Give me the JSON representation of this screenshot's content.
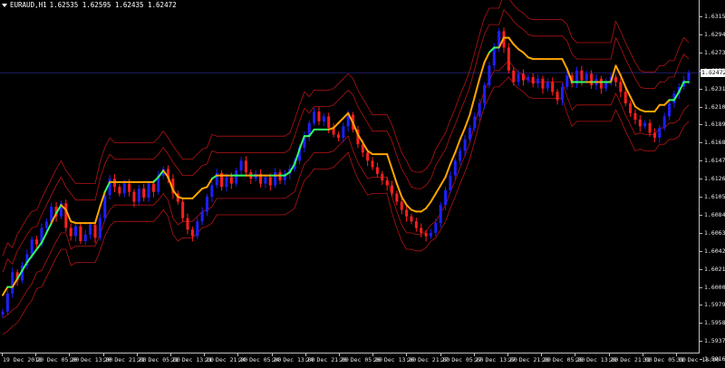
{
  "header": {
    "symbol": "EURAUD,H1",
    "ohlc": "1.62535 1.62595 1.62435 1.62472"
  },
  "price_axis": {
    "labels": [
      "1.63155",
      "1.62945",
      "1.62735",
      "1.62525",
      "1.62315",
      "1.62105",
      "1.61895",
      "1.61685",
      "1.61475",
      "1.61265",
      "1.61055",
      "1.60845",
      "1.60635",
      "1.60425",
      "1.60215",
      "1.60000",
      "1.59790",
      "1.59580",
      "1.59370",
      "1.59165"
    ],
    "current_price": "1.62472"
  },
  "time_axis": {
    "labels": [
      "19 Dec 2018",
      "20 Dec 05:00",
      "20 Dec 13:00",
      "20 Dec 21:00",
      "21 Dec 05:00",
      "21 Dec 13:00",
      "21 Dec 21:00",
      "24 Dec 05:00",
      "24 Dec 13:00",
      "24 Dec 21:00",
      "26 Dec 05:00",
      "26 Dec 13:00",
      "26 Dec 21:00",
      "27 Dec 05:00",
      "27 Dec 13:00",
      "27 Dec 21:00",
      "28 Dec 05:00",
      "28 Dec 13:00",
      "28 Dec 21:00",
      "31 Dec 05:00",
      "31 Dec 13:00"
    ]
  },
  "colors": {
    "background": "#000000",
    "bull_candle": "#1f1fff",
    "bear_candle": "#ff1f1f",
    "trend_up_line": "#33ff66",
    "trend_down_line": "#ffa500",
    "envelope_lines": "#b31414",
    "grid_line": "#1c1c60",
    "axis_text": "#e8e8e8"
  },
  "chart_data": {
    "type": "candlestick",
    "ylim": [
      1.5906,
      1.6336
    ],
    "close_series": [
      1.5956,
      1.5978,
      1.6004,
      1.5994,
      1.6012,
      1.6026,
      1.6044,
      1.6038,
      1.6058,
      1.6066,
      1.6084,
      1.6072,
      1.6088,
      1.6058,
      1.6048,
      1.606,
      1.6042,
      1.605,
      1.6062,
      1.6046,
      1.607,
      1.6098,
      1.6118,
      1.6108,
      1.61,
      1.6112,
      1.6102,
      1.609,
      1.6106,
      1.6095,
      1.6112,
      1.6102,
      1.6122,
      1.613,
      1.6118,
      1.61,
      1.609,
      1.607,
      1.6056,
      1.6048,
      1.6066,
      1.6078,
      1.6096,
      1.611,
      1.6125,
      1.6108,
      1.612,
      1.6112,
      1.6128,
      1.614,
      1.6126,
      1.6118,
      1.6124,
      1.6112,
      1.612,
      1.611,
      1.6126,
      1.6116,
      1.6124,
      1.613,
      1.614,
      1.6156,
      1.617,
      1.6186,
      1.62,
      1.6188,
      1.6194,
      1.618,
      1.6172,
      1.6168,
      1.6182,
      1.6196,
      1.6178,
      1.616,
      1.615,
      1.614,
      1.6132,
      1.6124,
      1.6116,
      1.611,
      1.61,
      1.609,
      1.608,
      1.6072,
      1.6066,
      1.6058,
      1.6052,
      1.6048,
      1.6052,
      1.6064,
      1.6086,
      1.6104,
      1.6122,
      1.614,
      1.6152,
      1.6166,
      1.618,
      1.6194,
      1.621,
      1.6232,
      1.6256,
      1.6278,
      1.6298,
      1.6278,
      1.625,
      1.6236,
      1.6246,
      1.6238,
      1.6242,
      1.6234,
      1.624,
      1.6228,
      1.6236,
      1.6224,
      1.6214,
      1.623,
      1.6244,
      1.6234,
      1.625,
      1.6238,
      1.6246,
      1.6232,
      1.624,
      1.6228,
      1.6236,
      1.6242,
      1.6236,
      1.6224,
      1.621,
      1.6198,
      1.619,
      1.6182,
      1.6186,
      1.6174,
      1.6168,
      1.618,
      1.6194,
      1.621,
      1.6222,
      1.623,
      1.6238,
      1.6247
    ],
    "trend_line": [
      1.5976,
      1.5986,
      1.5986,
      1.5996,
      1.6006,
      1.6016,
      1.6024,
      1.6032,
      1.604,
      1.6052,
      1.6064,
      1.6076,
      1.6086,
      1.608,
      1.6066,
      1.6064,
      1.6064,
      1.6064,
      1.6064,
      1.6064,
      1.6084,
      1.6102,
      1.6114,
      1.6114,
      1.6114,
      1.6114,
      1.6114,
      1.6114,
      1.6114,
      1.6114,
      1.6114,
      1.6114,
      1.612,
      1.6128,
      1.612,
      1.6104,
      1.6096,
      1.6094,
      1.6094,
      1.6094,
      1.61,
      1.6106,
      1.6108,
      1.6118,
      1.6122,
      1.6122,
      1.6122,
      1.6122,
      1.6122,
      1.6122,
      1.6122,
      1.6122,
      1.6122,
      1.6122,
      1.6122,
      1.6122,
      1.6122,
      1.6122,
      1.6122,
      1.6126,
      1.6136,
      1.6154,
      1.617,
      1.617,
      1.6178,
      1.6178,
      1.6178,
      1.6178,
      1.618,
      1.6186,
      1.6192,
      1.6198,
      1.6186,
      1.6172,
      1.6162,
      1.6152,
      1.6148,
      1.6148,
      1.6148,
      1.6148,
      1.613,
      1.6112,
      1.6096,
      1.6086,
      1.608,
      1.6078,
      1.6078,
      1.6082,
      1.609,
      1.61,
      1.611,
      1.612,
      1.6136,
      1.615,
      1.6166,
      1.618,
      1.6196,
      1.6218,
      1.624,
      1.626,
      1.6272,
      1.6278,
      1.6278,
      1.629,
      1.629,
      1.6282,
      1.6276,
      1.6272,
      1.6266,
      1.6264,
      1.6264,
      1.6264,
      1.6264,
      1.6264,
      1.6264,
      1.6264,
      1.6252,
      1.6236,
      1.6236,
      1.6236,
      1.6236,
      1.6236,
      1.6236,
      1.6236,
      1.6236,
      1.6236,
      1.6256,
      1.6244,
      1.623,
      1.6218,
      1.6206,
      1.6202,
      1.62,
      1.62,
      1.62,
      1.6208,
      1.6208,
      1.6214,
      1.6214,
      1.6224,
      1.6236,
      1.6236
    ]
  }
}
